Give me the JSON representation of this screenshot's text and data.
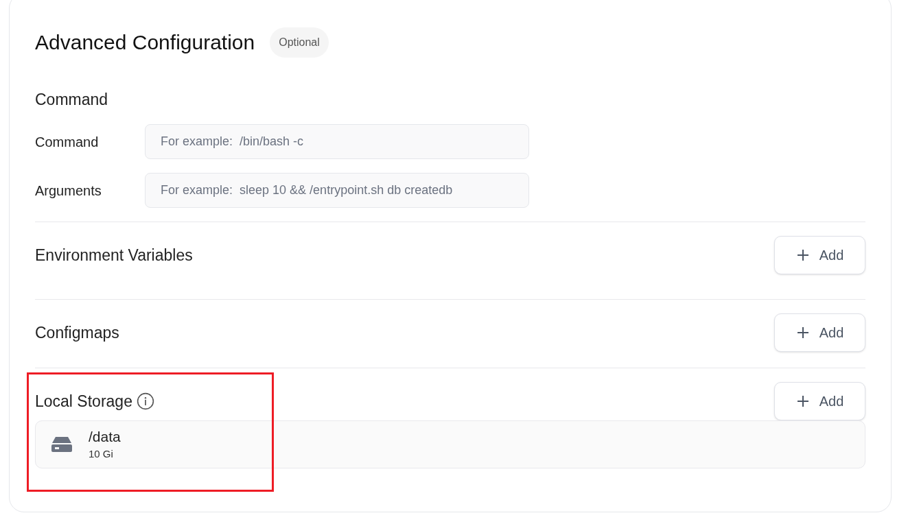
{
  "title": "Advanced Configuration",
  "badge": "Optional",
  "command_section": {
    "heading": "Command",
    "fields": [
      {
        "label": "Command",
        "placeholder": "For example:  /bin/bash -c"
      },
      {
        "label": "Arguments",
        "placeholder": "For example:  sleep 10 && /entrypoint.sh db createdb"
      }
    ]
  },
  "sections": [
    {
      "heading": "Environment Variables",
      "info": false,
      "button": "Add"
    },
    {
      "heading": "Configmaps",
      "info": false,
      "button": "Add"
    },
    {
      "heading": "Local Storage",
      "info": true,
      "button": "Add",
      "volumes": [
        {
          "path": "/data",
          "size": "10 Gi"
        }
      ]
    }
  ]
}
